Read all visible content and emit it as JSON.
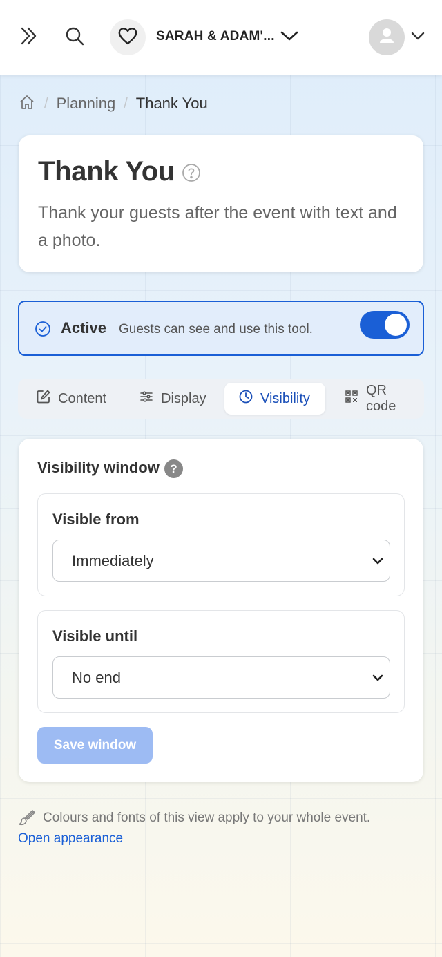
{
  "header": {
    "event_name": "SARAH & ADAM'...",
    "icons": {
      "expand": "double-chevron-right-icon",
      "search": "search-icon",
      "event": "heart-icon",
      "event_menu": "chevron-down-icon",
      "avatar": "user-avatar-icon",
      "account_menu": "chevron-down-icon"
    }
  },
  "breadcrumb": {
    "home_icon": "home-icon",
    "items": [
      "Planning",
      "Thank You"
    ]
  },
  "title_card": {
    "title": "Thank You",
    "description": "Thank your guests after the event with text and a photo."
  },
  "status": {
    "label": "Active",
    "hint": "Guests can see and use this tool.",
    "toggle_on": true
  },
  "tabs": [
    {
      "label": "Content",
      "icon": "edit-icon",
      "active": false
    },
    {
      "label": "Display",
      "icon": "sliders-icon",
      "active": false
    },
    {
      "label": "Visibility",
      "icon": "clock-icon",
      "active": true
    },
    {
      "label": "QR code",
      "icon": "qr-code-icon",
      "active": false
    }
  ],
  "visibility": {
    "section_title": "Visibility window",
    "help_symbol": "?",
    "from": {
      "label": "Visible from",
      "value": "Immediately"
    },
    "until": {
      "label": "Visible until",
      "value": "No end"
    },
    "save_label": "Save window"
  },
  "appearance": {
    "note": "Colours and fonts of this view apply to your whole event.",
    "link": "Open appearance"
  },
  "colors": {
    "accent": "#1a5fd6",
    "active_bg": "#e2edfb",
    "save_disabled": "#9dbbf3"
  }
}
